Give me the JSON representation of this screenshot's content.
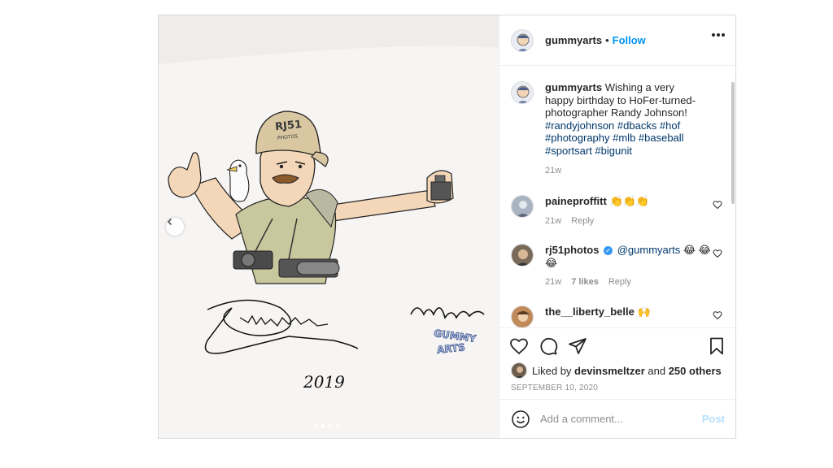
{
  "post": {
    "author": "gummyarts",
    "follow_label": "Follow",
    "separator": "•",
    "caption_parts": {
      "text": "Wishing a very happy birthday to HoFer-turned-photographer Randy Johnson!",
      "hashtags": "#randyjohnson #dbacks #hof #photography #mlb #baseball #sportsart #bigunit"
    },
    "caption_age": "21w",
    "artwork_text": {
      "cap": "RJ51",
      "cap_sub": "PHOTOS",
      "year": "2019",
      "logo_line1": "GUMMY",
      "logo_line2": "ARTS"
    },
    "carousel": {
      "count": 4,
      "active_index": 1
    }
  },
  "comments": [
    {
      "user": "paineproffitt",
      "text": "👏👏👏",
      "age": "21w",
      "reply": "Reply"
    },
    {
      "user": "rj51photos",
      "verified": true,
      "mention": "@gummyarts",
      "text": "😂 😂😂",
      "age": "21w",
      "likes": "7 likes",
      "reply": "Reply"
    },
    {
      "user": "the__liberty_belle",
      "text": "🙌"
    }
  ],
  "likes": {
    "prefix": "Liked by",
    "user": "devinsmeltzer",
    "middle": "and",
    "others": "250 others"
  },
  "date": "SEPTEMBER 10, 2020",
  "add_comment": {
    "placeholder": "Add a comment...",
    "post_label": "Post"
  },
  "colors": {
    "link": "#0095f6",
    "tag": "#00376b",
    "muted": "#8e8e8e",
    "post_disabled": "#b2dffc"
  }
}
